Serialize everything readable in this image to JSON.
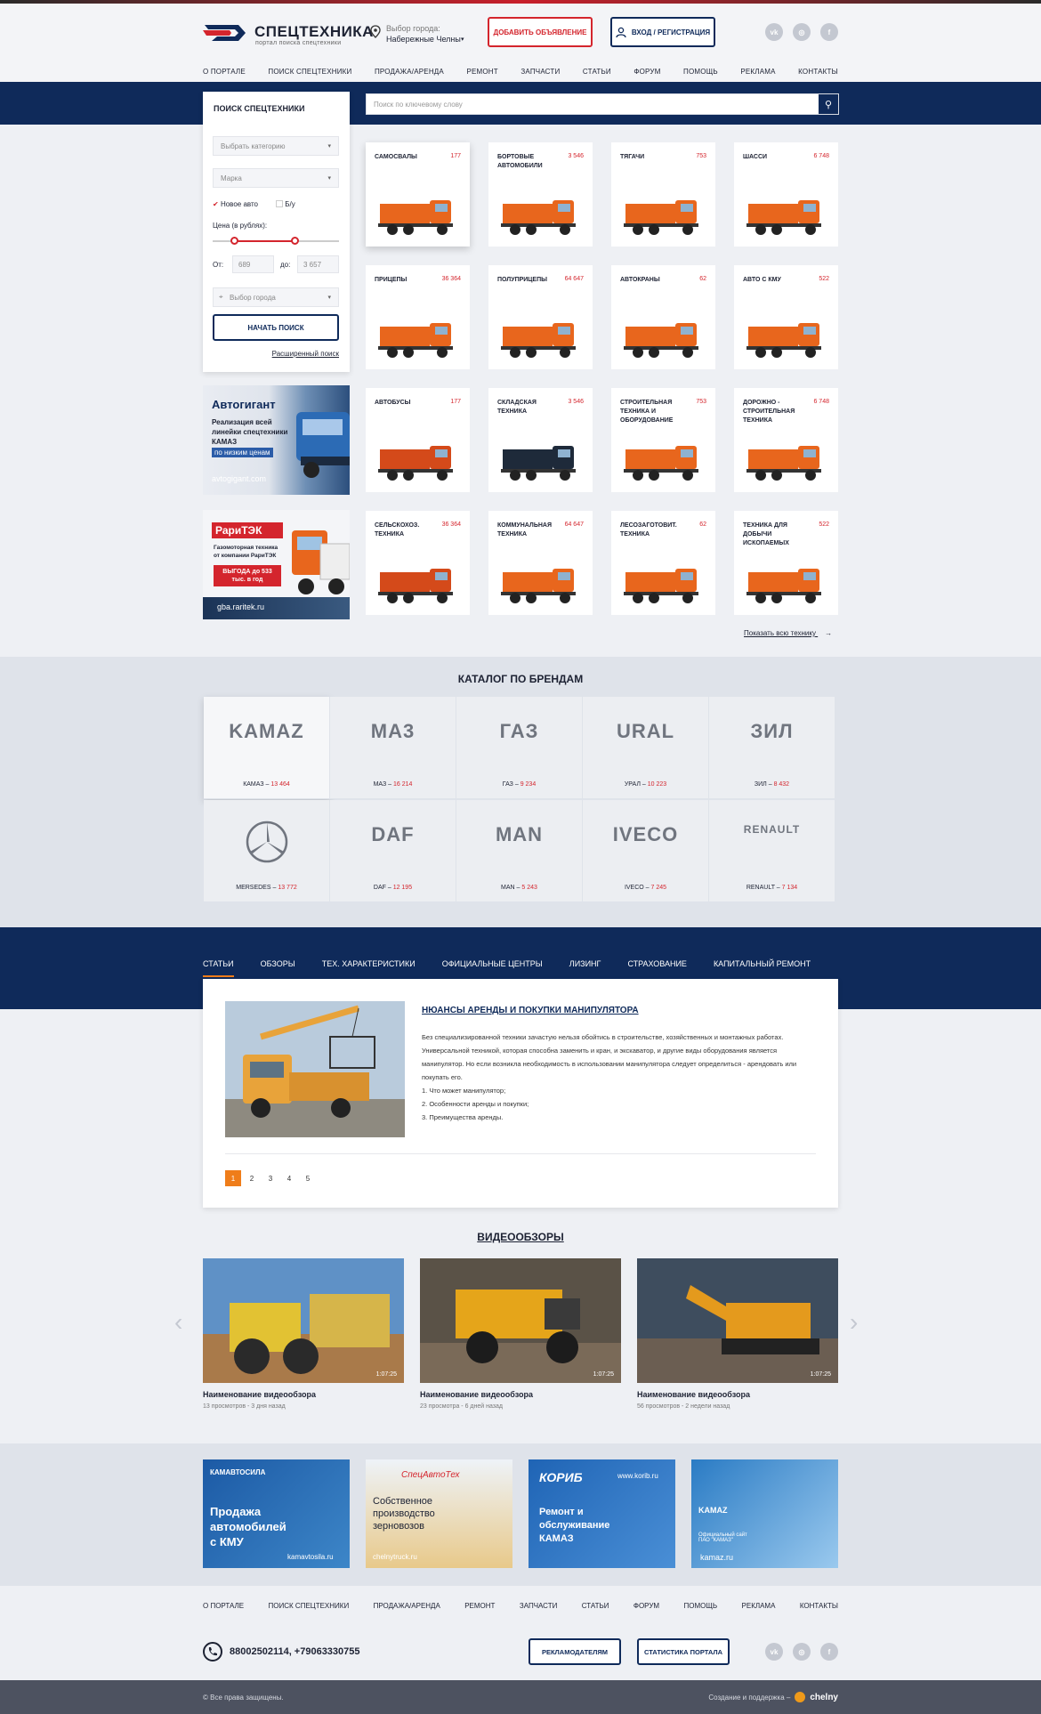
{
  "header": {
    "logo_title": "СПЕЦТЕХНИКА",
    "logo_sub": "портал поиска спецтехники",
    "city_label": "Выбор города:",
    "city_value": "Набережные Челны",
    "add_button": "Добавить объявление",
    "login_button": "Вход / регистрация",
    "social": [
      "vk-icon",
      "instagram-icon",
      "facebook-icon"
    ]
  },
  "nav": [
    "О портале",
    "Поиск спецтехники",
    "Продажа/аренда",
    "Ремонт",
    "Запчасти",
    "Статьи",
    "Форум",
    "Помощь",
    "Реклама",
    "Контакты"
  ],
  "search": {
    "title": "Поиск спецтехники",
    "category_placeholder": "Выбрать категорию",
    "brand_placeholder": "Марка",
    "new_label": "Новое авто",
    "used_label": "Б/у",
    "price_label": "Цена (в рублях):",
    "from_label": "От:",
    "from_value": "689",
    "to_label": "до:",
    "to_value": "3 657",
    "city_placeholder": "Выбор города",
    "start_button": "Начать поиск",
    "advanced_link": "Расширенный поиск",
    "keyword_placeholder": "Поиск по ключевому слову"
  },
  "ads_side": [
    {
      "title": "Автогигант",
      "text": "Реализация всей линейки спецтехники КАМАЗ",
      "accent": "по низким ценам",
      "site": "avtogigant.com"
    },
    {
      "title": "РариТЭК",
      "text": "Газомоторная техника от компании РариТЭК",
      "accent": "ВЫГОДА до 533 тыс. в год",
      "site": "gba.raritek.ru"
    }
  ],
  "categories": [
    {
      "title": "Самосвалы",
      "count": "177"
    },
    {
      "title": "Бортовые автомобили",
      "count": "3 546"
    },
    {
      "title": "Тягачи",
      "count": "753"
    },
    {
      "title": "Шасси",
      "count": "6 748"
    },
    {
      "title": "Прицепы",
      "count": "36 364"
    },
    {
      "title": "Полуприцепы",
      "count": "64 647"
    },
    {
      "title": "Автокраны",
      "count": "62"
    },
    {
      "title": "Авто с КМУ",
      "count": "522"
    },
    {
      "title": "Автобусы",
      "count": "177"
    },
    {
      "title": "Складская техника",
      "count": "3 546"
    },
    {
      "title": "Строительная техника и оборудование",
      "count": "753"
    },
    {
      "title": "Дорожно - строительная техника",
      "count": "6 748"
    },
    {
      "title": "Сельскохоз. техника",
      "count": "36 364"
    },
    {
      "title": "Коммунальная техника",
      "count": "64 647"
    },
    {
      "title": "Лесозаготовит. техника",
      "count": "62"
    },
    {
      "title": "Техника для добычи ископаемых",
      "count": "522"
    }
  ],
  "show_all": "Показать всю технику",
  "brands_title": "Каталог по брендам",
  "brands": [
    {
      "name": "КАМАЗ",
      "count": "13 464",
      "logo": "KAMAZ"
    },
    {
      "name": "МАЗ",
      "count": "16 214",
      "logo": "MA3"
    },
    {
      "name": "ГАЗ",
      "count": "9 234",
      "logo": "ГАЗ"
    },
    {
      "name": "УРАЛ",
      "count": "10 223",
      "logo": "URAL"
    },
    {
      "name": "ЗИЛ",
      "count": "8 432",
      "logo": "ЗИЛ"
    },
    {
      "name": "MERSEDES",
      "count": "13 772",
      "logo": ""
    },
    {
      "name": "DAF",
      "count": "12 195",
      "logo": "DAF"
    },
    {
      "name": "MAN",
      "count": "5 243",
      "logo": "MAN"
    },
    {
      "name": "IVECO",
      "count": "7 245",
      "logo": "IVECO"
    },
    {
      "name": "RENAULT",
      "count": "7 134",
      "logo": "RENAULT"
    }
  ],
  "article_tabs": [
    "Статьи",
    "Обзоры",
    "Тех. характеристики",
    "Официальные центры",
    "Лизинг",
    "Страхование",
    "Капитальный ремонт"
  ],
  "article": {
    "title": "Нюансы аренды и покупки манипулятора",
    "body": "Без специализированной техники зачастую нельзя обойтись в строительстве, хозяйственных и монтажных работах. Универсальной техникой, которая способна заменить и кран, и экскаватор, и другие виды оборудования является манипулятор. Но если возникла необходимость в использовании манипулятора следует определиться - арендовать или покупать его.",
    "list": [
      "1. Что может манипулятор;",
      "2. Особенности аренды и покупки;",
      "3. Преимущества аренды."
    ],
    "pages": [
      "1",
      "2",
      "3",
      "4",
      "5"
    ]
  },
  "video_title": "Видеообзоры",
  "videos": [
    {
      "title": "Наименование видеообзора",
      "meta": "13 просмотров - 3 дня назад",
      "time": "1:07:25"
    },
    {
      "title": "Наименование видеообзора",
      "meta": "23 просмотра - 6 дней назад",
      "time": "1:07:25"
    },
    {
      "title": "Наименование видеообзора",
      "meta": "56 просмотров - 2 недели назад",
      "time": "1:07:25"
    }
  ],
  "ads_bottom": [
    {
      "brand": "КАМАВТОСИЛА",
      "text": "Продажа автомобилей с КМУ",
      "site": "kamavtosila.ru"
    },
    {
      "brand": "СпецАвтоТех",
      "text": "Собственное производство зерновозов",
      "site": "chelnytruck.ru"
    },
    {
      "brand": "КОРИБ",
      "text": "Ремонт и обслуживание КАМАЗ",
      "site": "www.korib.ru"
    },
    {
      "brand": "KAMAZ",
      "text": "Официальный сайт ПАО \"КАМАЗ\"",
      "site": "kamaz.ru"
    }
  ],
  "footer": {
    "phone": "88002502114, +79063330755",
    "btn_ads": "Рекламодателям",
    "btn_stats": "Статистика портала",
    "copyright": "© Все права защищены.",
    "made_by": "Создание и поддержка –",
    "studio": "chelny"
  },
  "colors": {
    "primary": "#0f2a5a",
    "accent": "#d4252d",
    "orange": "#ef7d1a"
  }
}
